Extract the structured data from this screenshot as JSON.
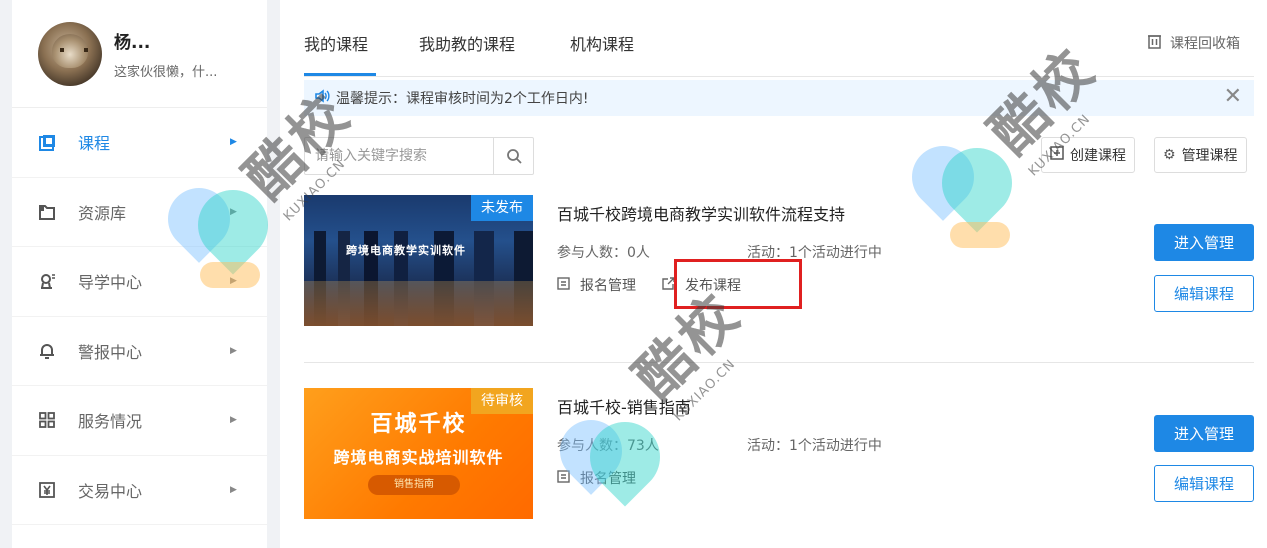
{
  "profile": {
    "name": "杨...",
    "signature": "这家伙很懒，什..."
  },
  "sidebar": {
    "items": [
      {
        "label": "课程",
        "icon": "course-icon"
      },
      {
        "label": "资源库",
        "icon": "folder-icon"
      },
      {
        "label": "导学中心",
        "icon": "guide-icon"
      },
      {
        "label": "警报中心",
        "icon": "bell-icon"
      },
      {
        "label": "服务情况",
        "icon": "grid-icon"
      },
      {
        "label": "交易中心",
        "icon": "yen-icon"
      }
    ],
    "active_index": 0
  },
  "tabs": [
    "我的课程",
    "我助教的课程",
    "机构课程"
  ],
  "recycle_label": "课程回收箱",
  "notice": {
    "text": "温馨提示：课程审核时间为2个工作日内!"
  },
  "search": {
    "placeholder": "请输入关键字搜索"
  },
  "toolbar": {
    "create_label": "创建课程",
    "manage_label": "管理课程"
  },
  "courses": [
    {
      "badge": "未发布",
      "thumb_text": "跨境电商教学实训软件",
      "title": "百城千校跨境电商教学实训软件流程支持",
      "participants": "参与人数：0人",
      "activity": "活动：1个活动进行中",
      "links": [
        "报名管理",
        "发布课程"
      ],
      "enter_label": "进入管理",
      "edit_label": "编辑课程"
    },
    {
      "badge": "待审核",
      "thumb_text1": "百城千校",
      "thumb_text2": "跨境电商实战培训软件",
      "thumb_pill": "销售指南",
      "title": "百城千校-销售指南",
      "participants": "参与人数：73人",
      "activity": "活动：1个活动进行中",
      "links": [
        "报名管理"
      ],
      "enter_label": "进入管理",
      "edit_label": "编辑课程"
    }
  ],
  "watermark": {
    "big": "酷校",
    "small": "KUXIAO.CN"
  },
  "colors": {
    "accent": "#1e88e5",
    "highlight": "#e02020",
    "badge_pending": "#f2a51f"
  }
}
